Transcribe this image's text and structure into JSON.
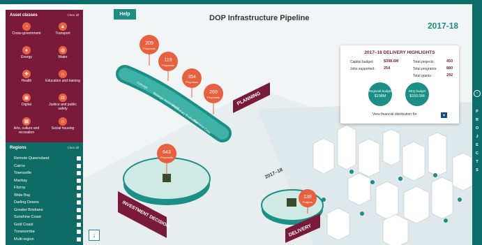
{
  "asset_panel": {
    "title": "Asset classes",
    "clear": "Clear all",
    "items": [
      {
        "label": "Cross-government",
        "icon": "cross-government-icon",
        "glyph": "◔"
      },
      {
        "label": "Transport",
        "icon": "transport-icon",
        "glyph": "▲"
      },
      {
        "label": "Energy",
        "icon": "energy-icon",
        "glyph": "●"
      },
      {
        "label": "Water",
        "icon": "water-icon",
        "glyph": "◍"
      },
      {
        "label": "Health",
        "icon": "health-icon",
        "glyph": "✚"
      },
      {
        "label": "Education and training",
        "icon": "education-icon",
        "glyph": "⌂"
      },
      {
        "label": "Digital",
        "icon": "digital-icon",
        "glyph": "▣"
      },
      {
        "label": "Justice and public safety",
        "icon": "justice-icon",
        "glyph": "⚖"
      },
      {
        "label": "Arts, culture and recreation",
        "icon": "arts-icon",
        "glyph": "▦"
      },
      {
        "label": "Social housing",
        "icon": "housing-icon",
        "glyph": "⌂"
      }
    ]
  },
  "regions_panel": {
    "title": "Regions",
    "clear": "Clear all",
    "items": [
      "Remote Queensland",
      "Cairns",
      "Townsville",
      "Mackay",
      "Fitzroy",
      "Wide Bay",
      "Darling Downs",
      "Greater Brisbane",
      "Sunshine Coast",
      "Gold Coast",
      "Toowoomba",
      "Multi-region"
    ]
  },
  "header": {
    "help": "Help",
    "title": "DOP Infrastructure Pipeline",
    "year": "2017-18"
  },
  "stages": {
    "planning": "PLANNING",
    "investment": "INVESTMENT DECISION",
    "delivery": "DELIVERY",
    "year_marker": "2017–18",
    "pipes": [
      "Concept",
      "Strategic Assessment",
      "Preliminary Evaluation",
      "Business Case"
    ]
  },
  "bubbles": [
    {
      "value": "209",
      "label": "Proposals"
    },
    {
      "value": "119",
      "label": "Proposals"
    },
    {
      "value": "354",
      "label": "Proposals"
    },
    {
      "value": "269",
      "label": "Proposals"
    },
    {
      "value": "643",
      "label": "Proposals"
    },
    {
      "value": "138",
      "label": "Projects"
    }
  ],
  "highlights": {
    "title": "2017–18 DELIVERY HIGHLIGHTS",
    "capital_budget_label": "Capital budget:",
    "capital_budget": "$398.6M",
    "jobs_label": "Jobs supported:",
    "jobs": "254",
    "total_projects_label": "Total projects:",
    "total_projects": "450",
    "total_programs_label": "Total programs:",
    "total_programs": "880",
    "total_grants_label": "Total grants:",
    "total_grants": "292",
    "regional_label": "Regional budget",
    "regional_value": "$198M",
    "seq_label": "SEQ budget",
    "seq_value": "$150.5M",
    "footer": "View financial distribution for"
  },
  "projects_tab": {
    "letters": [
      "P",
      "R",
      "O",
      "J",
      "E",
      "C",
      "T",
      "S"
    ]
  },
  "colors": {
    "maroon": "#7a1a3a",
    "teal": "#1b8f86",
    "orange": "#e9603f"
  }
}
